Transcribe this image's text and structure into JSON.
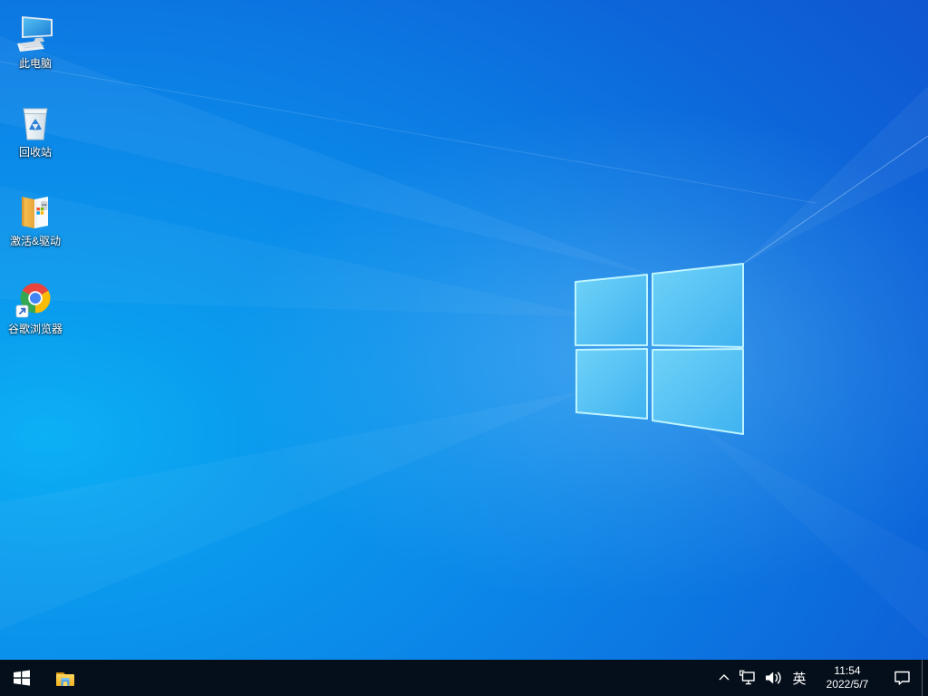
{
  "wallpaper": {
    "name": "windows-10-default-light",
    "colors": {
      "corner_deep_blue": "#1247c9",
      "mid_blue": "#0b86e8",
      "bottom_left_light": "#0cb0f5",
      "logo_pane_light": "#6fd2f8",
      "logo_pane_dark": "#3fb2f0",
      "logo_edge": "#bef4ff"
    }
  },
  "desktop": {
    "icons": [
      {
        "id": "this-pc",
        "label": "此电脑",
        "icon": "computer-monitor-keyboard"
      },
      {
        "id": "recycle-bin",
        "label": "回收站",
        "icon": "empty-recycle-bin"
      },
      {
        "id": "activation-drivers",
        "label": "激活&驱动",
        "icon": "open-folder-with-files"
      },
      {
        "id": "google-chrome",
        "label": "谷歌浏览器",
        "icon": "chrome-shortcut"
      }
    ]
  },
  "taskbar": {
    "background": "#050f1b",
    "start": {
      "icon": "windows-logo"
    },
    "pinned": [
      {
        "id": "file-explorer",
        "icon": "yellow-folder"
      }
    ],
    "tray": {
      "chevron_icon": "chevron-up",
      "network_icon": "ethernet-monitor",
      "volume_icon": "speaker-waves",
      "ime": "英",
      "clock": {
        "time": "11:54",
        "date": "2022/5/7"
      },
      "action_center_icon": "speech-bubble",
      "show_desktop": "thin-strip"
    }
  }
}
